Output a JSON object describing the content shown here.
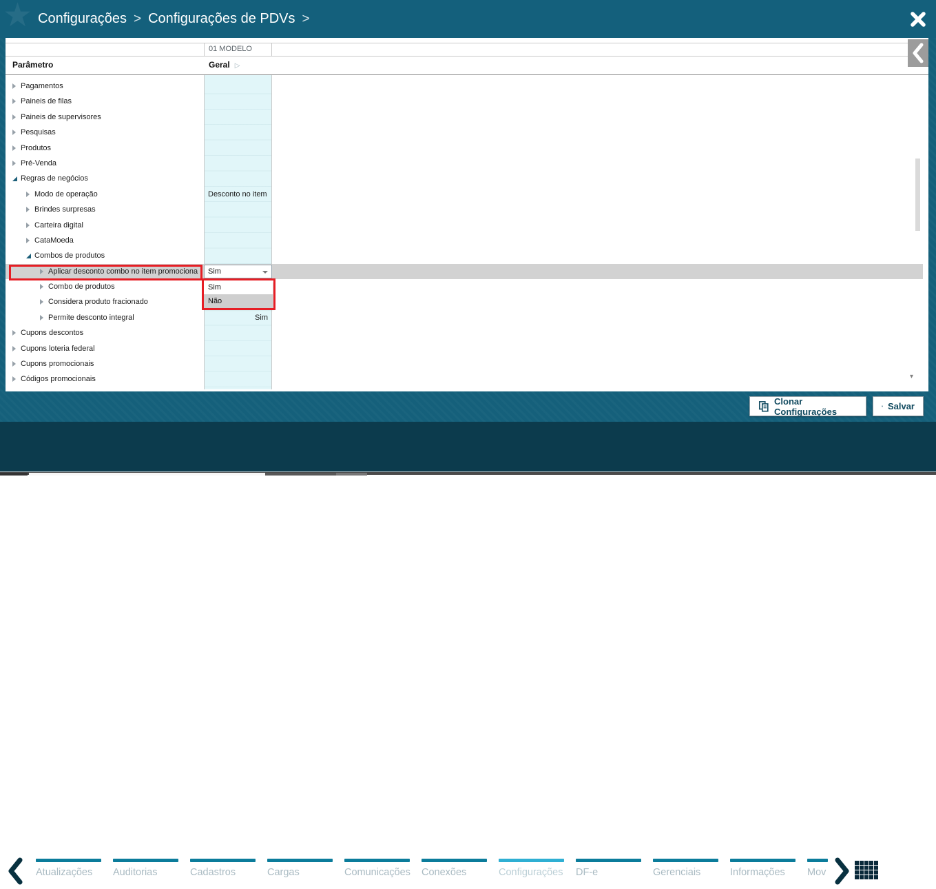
{
  "header": {
    "breadcrumb": [
      "Configurações",
      "Configurações de PDVs"
    ],
    "separator": ">"
  },
  "grid": {
    "model_header": "01 MODELO",
    "param_header": "Parâmetro",
    "group_header": "Geral",
    "rows": [
      {
        "label": "Pagamentos",
        "level": 0,
        "state": "collapsed"
      },
      {
        "label": "Paineis de filas",
        "level": 0,
        "state": "collapsed"
      },
      {
        "label": "Paineis de supervisores",
        "level": 0,
        "state": "collapsed"
      },
      {
        "label": "Pesquisas",
        "level": 0,
        "state": "collapsed"
      },
      {
        "label": "Produtos",
        "level": 0,
        "state": "collapsed"
      },
      {
        "label": "Pré-Venda",
        "level": 0,
        "state": "collapsed"
      },
      {
        "label": "Regras de negócios",
        "level": 0,
        "state": "expanded"
      },
      {
        "label": "Modo de operação",
        "level": 1,
        "state": "collapsed",
        "value": "Desconto no item",
        "value_align": "left"
      },
      {
        "label": "Brindes surpresas",
        "level": 1,
        "state": "collapsed"
      },
      {
        "label": "Carteira digital",
        "level": 1,
        "state": "collapsed"
      },
      {
        "label": "CataMoeda",
        "level": 1,
        "state": "collapsed"
      },
      {
        "label": "Combos de produtos",
        "level": 1,
        "state": "expanded"
      },
      {
        "label": "Aplicar desconto combo no item promociona",
        "level": 2,
        "state": "collapsed",
        "selected": true,
        "editor": {
          "type": "dropdown",
          "value": "Sim"
        }
      },
      {
        "label": "Combo de produtos",
        "level": 2,
        "state": "collapsed"
      },
      {
        "label": "Considera produto fracionado",
        "level": 2,
        "state": "collapsed"
      },
      {
        "label": "Permite desconto integral",
        "level": 2,
        "state": "collapsed",
        "value": "Sim",
        "value_align": "right"
      },
      {
        "label": "Cupons descontos",
        "level": 0,
        "state": "collapsed"
      },
      {
        "label": "Cupons loteria federal",
        "level": 0,
        "state": "collapsed"
      },
      {
        "label": "Cupons promocionais",
        "level": 0,
        "state": "collapsed"
      },
      {
        "label": "Códigos promocionais",
        "level": 0,
        "state": "collapsed"
      }
    ]
  },
  "dropdown": {
    "value": "Sim",
    "options": [
      "Sim",
      "Não"
    ],
    "highlighted": "Não"
  },
  "footer": {
    "buttons": [
      {
        "label": "Clonar Configurações",
        "icon": "clone-icon"
      },
      {
        "label": "Salvar",
        "icon": "save-icon"
      }
    ]
  },
  "nav": {
    "tabs": [
      {
        "label": "Atualizações"
      },
      {
        "label": "Auditorias"
      },
      {
        "label": "Cadastros"
      },
      {
        "label": "Cargas"
      },
      {
        "label": "Comunicações"
      },
      {
        "label": "Conexões"
      },
      {
        "label": "Configurações",
        "active": true
      },
      {
        "label": "DF-e"
      },
      {
        "label": "Gerenciais"
      },
      {
        "label": "Informações"
      },
      {
        "label": "Mov",
        "truncated": true
      }
    ]
  },
  "colors": {
    "header_teal": "#14607C",
    "nav_teal": "#0C3B4D",
    "tab_bar": "#0B7C9B",
    "tab_bar_active": "#2FAFD3",
    "column_cyan": "#E1F6F9",
    "selected_row_gray": "#D2D2D2",
    "annotation_red": "#E61E25",
    "button_text": "#114A5F"
  }
}
